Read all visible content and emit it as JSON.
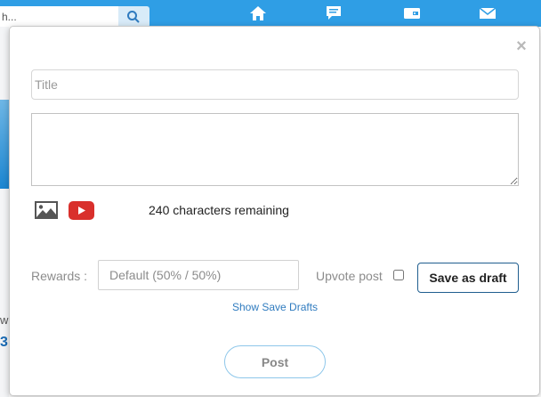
{
  "background": {
    "search": {
      "value": "h..."
    },
    "left_letter": "w",
    "left_digit": "3",
    "bottom_text": "..."
  },
  "icons": {
    "search": "search-icon",
    "home": "home-icon",
    "messages": "chat-icon",
    "wallet": "wallet-icon",
    "mail": "mail-icon",
    "image": "image-icon",
    "youtube": "youtube-icon",
    "close": "close-icon"
  },
  "colors": {
    "topbar": "#2f9ee5",
    "link": "#2f7bbf",
    "youtube_red": "#d9302c",
    "post_border": "#8ec7ea",
    "draft_border": "#1f5e8f"
  },
  "modal": {
    "close_label": "×",
    "title_placeholder": "Title",
    "body_value": "",
    "chars_remaining": "240 characters remaining",
    "rewards_label": "Rewards :",
    "rewards_placeholder": "Default (50% / 50%)",
    "upvote_label": "Upvote post",
    "save_draft_label": "Save as draft",
    "show_drafts_label": "Show Save Drafts",
    "post_label": "Post"
  }
}
